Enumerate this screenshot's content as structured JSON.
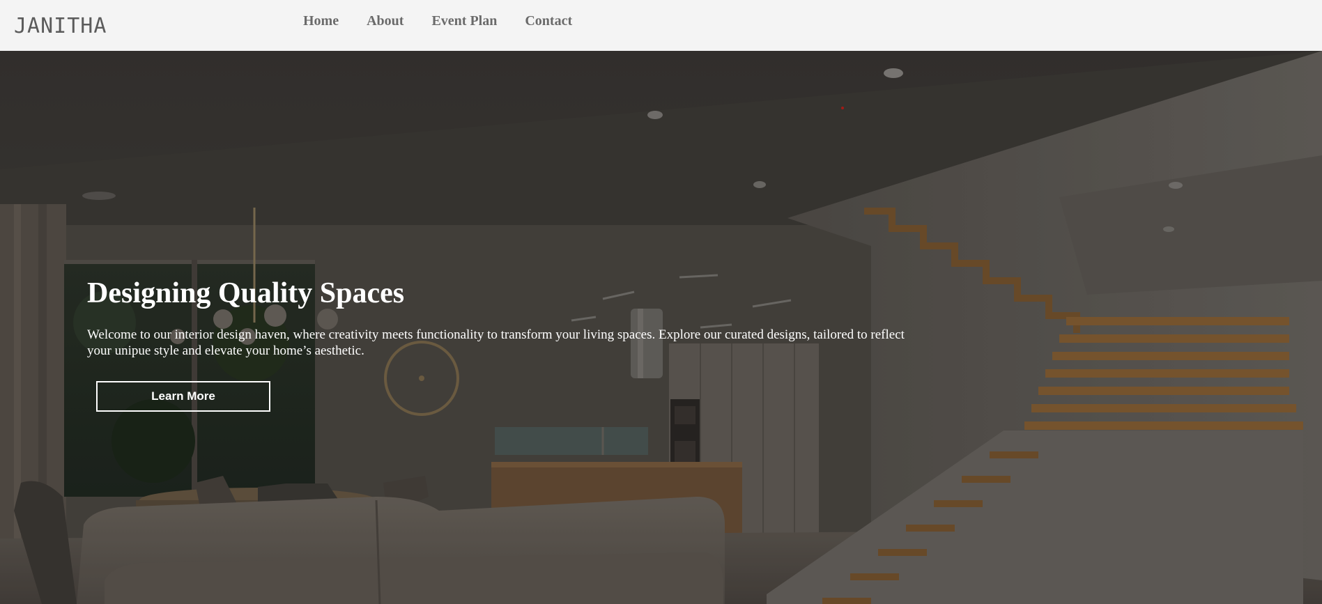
{
  "brand": {
    "name": "JANITHA"
  },
  "nav": {
    "items": [
      {
        "label": "Home"
      },
      {
        "label": "About"
      },
      {
        "label": "Event Plan"
      },
      {
        "label": "Contact"
      }
    ]
  },
  "hero": {
    "title": "Designing Quality Spaces",
    "text": "Welcome to our interior design haven, where creativity meets functionality to transform your living spaces. Explore our curated designs, tailored to reflect your unipue style and elevate your home’s aesthetic.",
    "button_label": "Learn More",
    "background_image": "interior-living-room-with-staircase"
  },
  "colors": {
    "header_bg": "#f4f4f4",
    "logo_text": "#5b5b5b",
    "nav_text": "#6a6a6a",
    "hero_text": "#ffffff",
    "button_border": "#ffffff"
  }
}
